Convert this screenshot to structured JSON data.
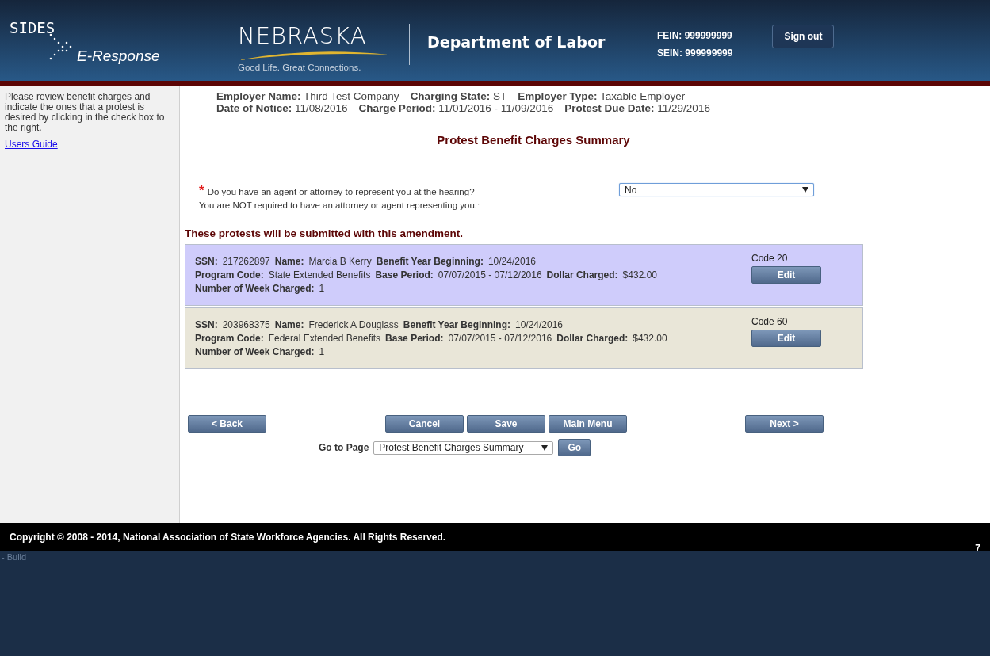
{
  "header": {
    "logo_top": "SIDES",
    "logo_bottom": "E-Response",
    "state_name": "NEBRASKA",
    "state_tagline": "Good Life. Great Connections.",
    "department": "Department of Labor",
    "ids": [
      "FEIN: 999999999",
      "SEIN: 999999999"
    ],
    "sign_out": "Sign out"
  },
  "sidebar": {
    "instructions": "Please review benefit charges and indicate the ones that a protest is desired by clicking in the check box to the right.",
    "link": "Users Guide"
  },
  "employer_info": [
    [
      {
        "label": "Employer Name:",
        "value": "Third Test Company"
      },
      {
        "label": "Charging State:",
        "value": "ST"
      },
      {
        "label": "Employer Type:",
        "value": "Taxable Employer"
      }
    ],
    [
      {
        "label": "Date of Notice:",
        "value": "11/08/2016"
      },
      {
        "label": "Charge Period:",
        "value": "11/01/2016 - 11/09/2016"
      },
      {
        "label": "Protest Due Date:",
        "value": "11/29/2016"
      }
    ]
  ],
  "page_title": "Protest Benefit Charges Summary",
  "agent_question": {
    "required_mark": "*",
    "question": "Do you have an agent or attorney to represent you at the hearing?",
    "note": "You are NOT required to have an attorney or agent representing you.:",
    "value": "No"
  },
  "protests_heading": "These protests will be submitted with this amendment.",
  "protests": [
    {
      "color": "#cfccfb",
      "code": "Code 20",
      "edit": "Edit",
      "lines": [
        [
          {
            "label": "SSN:",
            "value": "217262897"
          },
          {
            "label": "Name:",
            "value": "Marcia B Kerry"
          },
          {
            "label": "Benefit Year Beginning:",
            "value": "10/24/2016"
          }
        ],
        [
          {
            "label": "Program Code:",
            "value": "State Extended Benefits"
          },
          {
            "label": "Base Period:",
            "value": "07/07/2015 - 07/12/2016"
          },
          {
            "label": "Dollar Charged:",
            "value": "$432.00"
          }
        ],
        [
          {
            "label": "Number of Week Charged:",
            "value": "1"
          }
        ]
      ]
    },
    {
      "color": "#e9e6d8",
      "code": "Code 60",
      "edit": "Edit",
      "lines": [
        [
          {
            "label": "SSN:",
            "value": "203968375"
          },
          {
            "label": "Name:",
            "value": "Frederick A Douglass"
          },
          {
            "label": "Benefit Year Beginning:",
            "value": "10/24/2016"
          }
        ],
        [
          {
            "label": "Program Code:",
            "value": "Federal Extended Benefits"
          },
          {
            "label": "Base Period:",
            "value": "07/07/2015 - 07/12/2016"
          },
          {
            "label": "Dollar Charged:",
            "value": "$432.00"
          }
        ],
        [
          {
            "label": "Number of Week Charged:",
            "value": "1"
          }
        ]
      ]
    }
  ],
  "nav_buttons": {
    "back": "< Back",
    "middle": [
      "Cancel",
      "Save",
      "Main Menu"
    ],
    "next": "Next >"
  },
  "go_to_page": {
    "label": "Go to Page",
    "value": "Protest Benefit Charges Summary",
    "button": "Go"
  },
  "footer": {
    "copyright": "Copyright © 2008 - 2014, National Association of State Workforce Agencies. All Rights Reserved.",
    "build": "- Build",
    "version": "7"
  }
}
